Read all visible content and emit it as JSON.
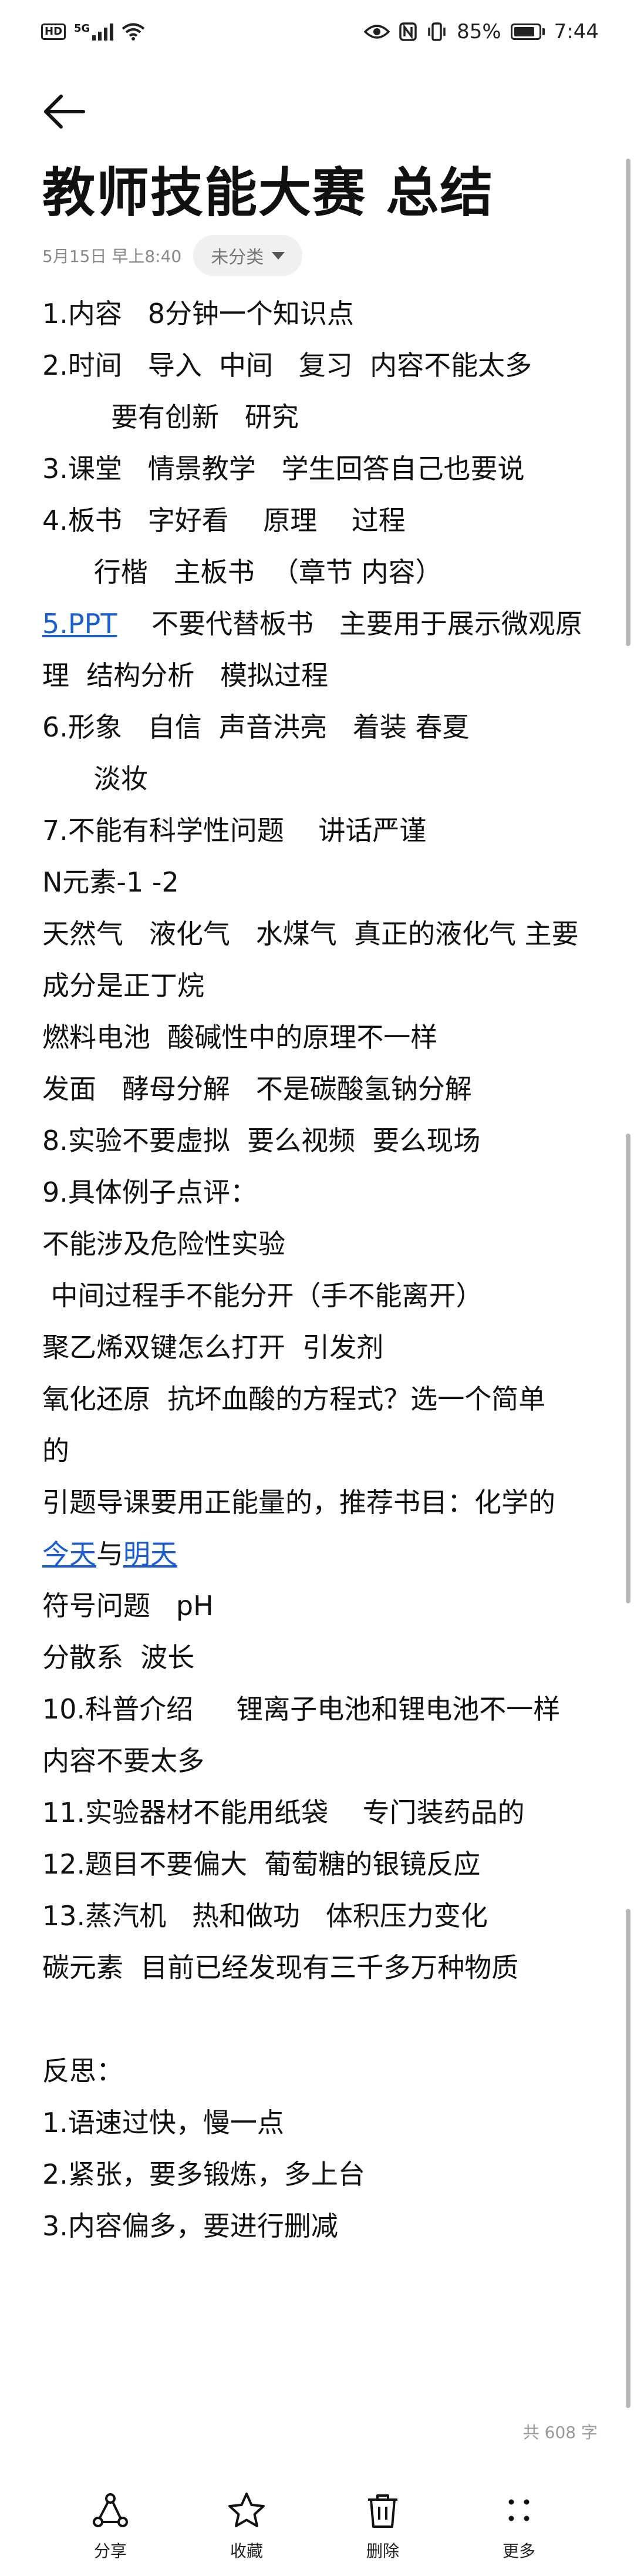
{
  "status_bar": {
    "hd": "HD",
    "network": "5G",
    "battery_percent": "85%",
    "battery_level": 0.85,
    "time": "7:44"
  },
  "note": {
    "title": "教师技能大赛 总结",
    "date": "5月15日 早上8:40",
    "category": "未分类",
    "lines": [
      [
        {
          "t": "1.内容   8分钟一个知识点"
        }
      ],
      [
        {
          "t": "2.时间   导入  中间   复习  内容不能太多"
        }
      ],
      [
        {
          "t": "        要有创新   研究"
        }
      ],
      [
        {
          "t": "3.课堂   情景教学   学生回答自己也要说"
        }
      ],
      [
        {
          "t": "4.板书   字好看    原理    过程"
        }
      ],
      [
        {
          "t": "      行楷   主板书  （章节 内容）"
        }
      ],
      [
        {
          "t": "5.PPT",
          "link": true
        },
        {
          "t": "    不要代替板书   主要用于展示微观原"
        }
      ],
      [
        {
          "t": "理  结构分析   模拟过程"
        }
      ],
      [
        {
          "t": "6.形象   自信  声音洪亮   着装 春夏"
        }
      ],
      [
        {
          "t": "      淡妆"
        }
      ],
      [
        {
          "t": "7.不能有科学性问题    讲话严谨"
        }
      ],
      [
        {
          "t": "N元素-1 -2"
        }
      ],
      [
        {
          "t": "天然气   液化气   水煤气  真正的液化气 主要"
        }
      ],
      [
        {
          "t": "成分是正丁烷"
        }
      ],
      [
        {
          "t": "燃料电池  酸碱性中的原理不一样"
        }
      ],
      [
        {
          "t": "发面   酵母分解   不是碳酸氢钠分解"
        }
      ],
      [
        {
          "t": "8.实验不要虚拟  要么视频  要么现场"
        }
      ],
      [
        {
          "t": "9.具体例子点评："
        }
      ],
      [
        {
          "t": "不能涉及危险性实验"
        }
      ],
      [
        {
          "t": " 中间过程手不能分开（手不能离开）"
        }
      ],
      [
        {
          "t": "聚乙烯双键怎么打开  引发剂"
        }
      ],
      [
        {
          "t": "氧化还原  抗坏血酸的方程式？选一个简单"
        }
      ],
      [
        {
          "t": "的"
        }
      ],
      [
        {
          "t": "引题导课要用正能量的，推荐书目：化学的"
        }
      ],
      [
        {
          "t": "今天",
          "link": true
        },
        {
          "t": "与"
        },
        {
          "t": "明天",
          "link": true
        }
      ],
      [
        {
          "t": "符号问题   pH"
        }
      ],
      [
        {
          "t": "分散系  波长"
        }
      ],
      [
        {
          "t": "10.科普介绍     锂离子电池和锂电池不一样"
        }
      ],
      [
        {
          "t": "内容不要太多"
        }
      ],
      [
        {
          "t": "11.实验器材不能用纸袋    专门装药品的"
        }
      ],
      [
        {
          "t": "12.题目不要偏大  葡萄糖的银镜反应"
        }
      ],
      [
        {
          "t": "13.蒸汽机   热和做功   体积压力变化"
        }
      ],
      [
        {
          "t": "碳元素  目前已经发现有三千多万种物质"
        }
      ],
      [
        {
          "t": ""
        }
      ],
      [
        {
          "t": "反思："
        }
      ],
      [
        {
          "t": "1.语速过快，慢一点"
        }
      ],
      [
        {
          "t": "2.紧张，要多锻炼，多上台"
        }
      ],
      [
        {
          "t": "3.内容偏多，要进行删减"
        }
      ]
    ],
    "word_count": "共 608 字"
  },
  "toolbar": [
    {
      "id": "share",
      "label": "分享",
      "icon": "share-icon"
    },
    {
      "id": "favorite",
      "label": "收藏",
      "icon": "star-icon"
    },
    {
      "id": "delete",
      "label": "删除",
      "icon": "trash-icon"
    },
    {
      "id": "more",
      "label": "更多",
      "icon": "more-icon"
    }
  ],
  "colors": {
    "link": "#1a5dd6",
    "scrollbar": "#b8b8b8"
  }
}
